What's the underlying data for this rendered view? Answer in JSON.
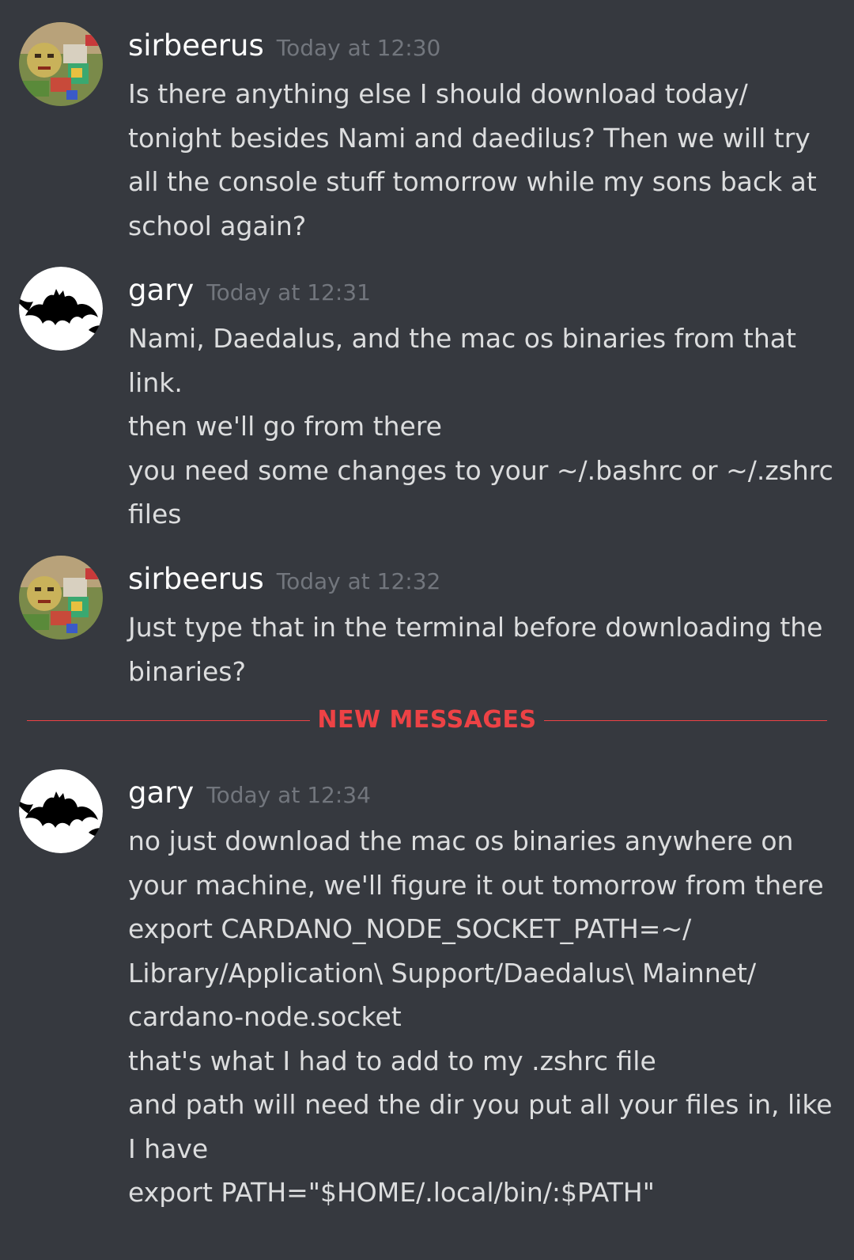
{
  "messages": [
    {
      "author": "sirbeerus",
      "timestamp": "Today at 12:30",
      "avatar_icon": "collage-avatar-icon",
      "lines": [
        "Is there anything else I should download today/",
        "tonight besides Nami and daedilus? Then we will try",
        "all the console stuff tomorrow while my sons back at",
        "school again?"
      ]
    },
    {
      "author": "gary",
      "timestamp": "Today at 12:31",
      "avatar_icon": "bat-avatar-icon",
      "lines": [
        "Nami, Daedalus, and the mac os binaries from that",
        "link.",
        "then we'll go from there",
        "you need some changes to your ~/.bashrc or ~/.zshrc",
        "files"
      ]
    },
    {
      "author": "sirbeerus",
      "timestamp": "Today at 12:32",
      "avatar_icon": "collage-avatar-icon",
      "lines": [
        "Just type that in the terminal before downloading the",
        "binaries?"
      ]
    },
    {
      "author": "gary",
      "timestamp": "Today at 12:34",
      "avatar_icon": "bat-avatar-icon",
      "lines": [
        "no just download the mac os binaries anywhere on",
        "your machine, we'll figure it out tomorrow from there",
        "export CARDANO_NODE_SOCKET_PATH=~/",
        "Library/Application\\ Support/Daedalus\\ Mainnet/",
        "cardano-node.socket",
        "that's what I had to add to my .zshrc file",
        "and path will need the dir you put all your files in, like",
        "I have",
        "export PATH=\"$HOME/.local/bin/:$PATH\""
      ]
    }
  ],
  "divider": {
    "label": "NEW MESSAGES"
  },
  "colors": {
    "background": "#36393f",
    "username": "#ffffff",
    "timestamp": "#72767d",
    "text": "#dcddde",
    "new_messages": "#ed4245"
  }
}
